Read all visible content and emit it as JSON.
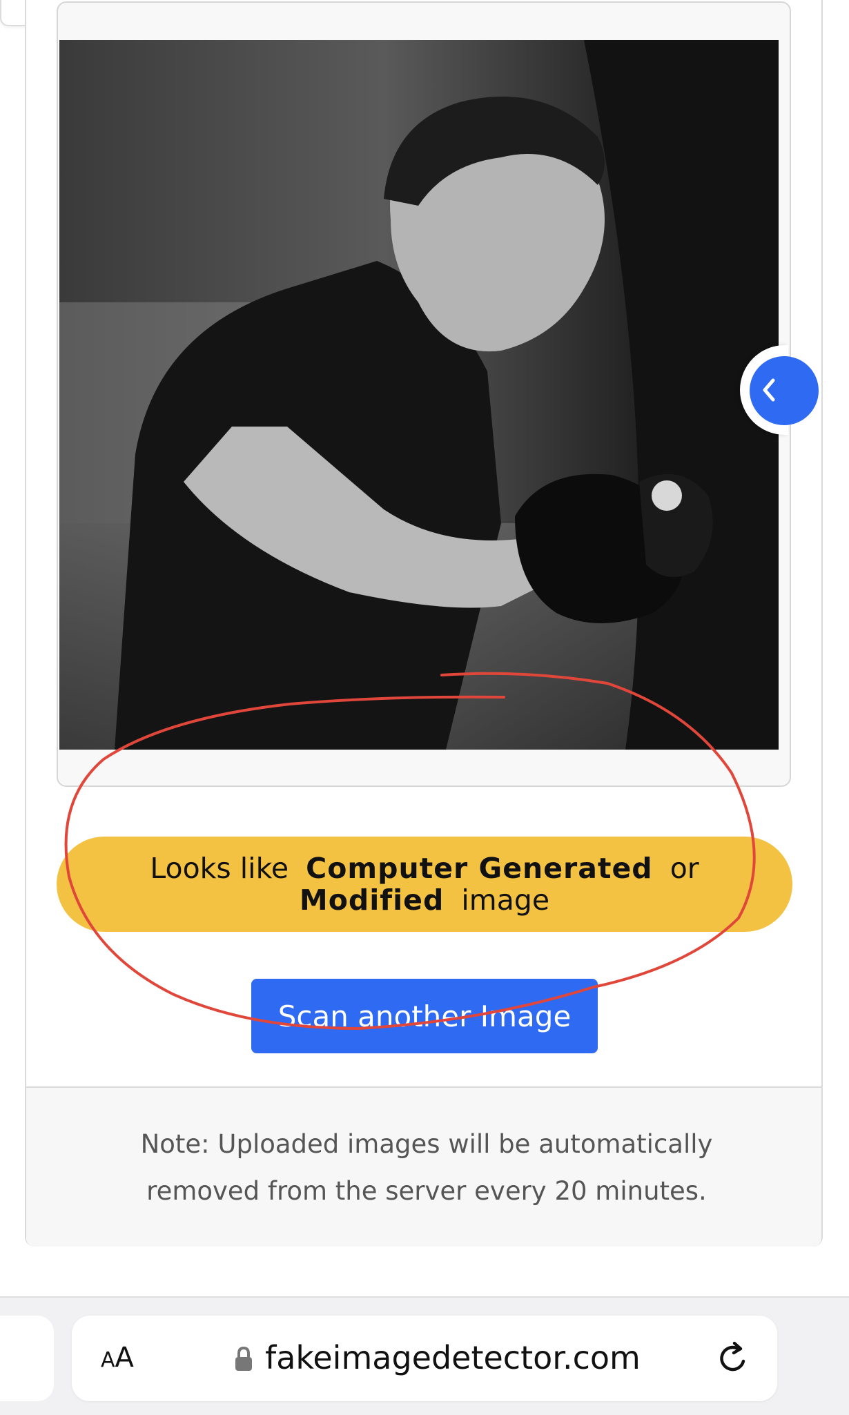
{
  "result": {
    "prefix": "Looks like",
    "emphasis_1": "Computer Generated",
    "connector": "or",
    "emphasis_2": "Modified",
    "suffix": "image",
    "color": "#f4c242"
  },
  "scan_button": {
    "label": "Scan another Image",
    "color": "#2f6af3"
  },
  "note": {
    "text": "Note: Uploaded images will be automatically removed from the server every 20 minutes."
  },
  "browser": {
    "text_size_label_small": "A",
    "text_size_label_large": "A",
    "url": "fakeimagedetector.com"
  },
  "photo": {
    "description_icon": "boxer-photo"
  },
  "icons": {
    "close": "close-icon",
    "collapse": "chevron-left-icon",
    "lock": "lock-icon",
    "reload": "reload-icon"
  },
  "annotation": {
    "color": "#e0473a"
  }
}
